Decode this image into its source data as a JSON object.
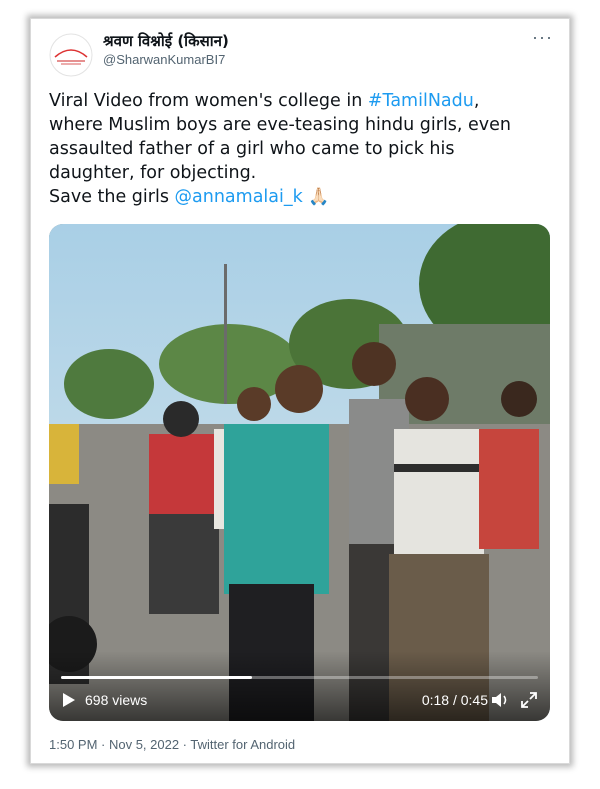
{
  "tweet": {
    "author_name": "श्रवण विश्नोई (किसान)",
    "author_handle": "@SharwanKumarBI7",
    "avatar_text": "ऋषिराज",
    "more_label": "···",
    "text_lines": [
      "Viral Video from women's college in ",
      "where Muslim boys are eve-teasing hindu girls, even",
      "assaulted father of a girl who came to pick his",
      "daughter, for objecting.",
      "Save the girls "
    ],
    "hashtag": "#TamilNadu",
    "trailing_comma": ",",
    "mention": "@annamalai_k",
    "emoji": "🙏🏻",
    "meta": "1:50 PM · Nov 5, 2022 · Twitter for Android"
  },
  "video": {
    "views": "698 views",
    "time": "0:18 / 0:45",
    "progress": 0.4,
    "play_icon": "play-icon",
    "volume_icon": "volume-icon",
    "fullscreen_icon": "fullscreen-icon"
  },
  "colors": {
    "link": "#1d9bf0",
    "text": "#0f1419",
    "muted": "#536471"
  }
}
